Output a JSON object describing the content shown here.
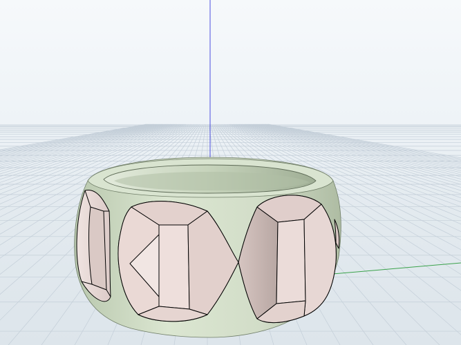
{
  "viewport": {
    "background_top": "#f6f9fb",
    "background_bottom": "#dde5eb",
    "grid_color": "#c3ced8",
    "z_axis_color": "#4b4ee0",
    "x_axis_color": "#39a24a"
  },
  "model": {
    "band_color": "#d5e0cc",
    "band_inner_color": "#c8d6bd",
    "band_inner_shadow": "#a7b79c",
    "facet_color": "#e8dad7",
    "facet_shadow": "#c9b9b6",
    "outline_color": "#000000"
  }
}
